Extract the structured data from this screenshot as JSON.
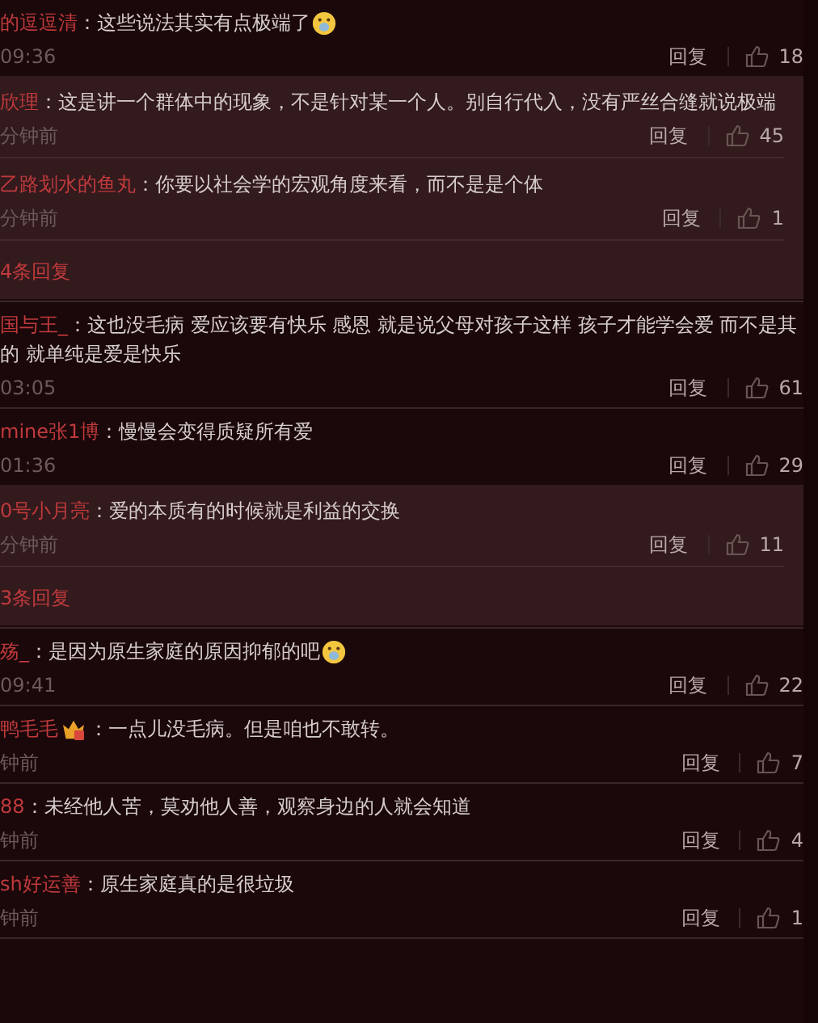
{
  "comments": [
    {
      "author": "的逗逗清",
      "text": "：这些说法其实有点极端了",
      "text_emoji": true,
      "author_badge": false,
      "time": "09:36",
      "reply": "回复",
      "likes": "18",
      "replies": [
        {
          "author": "欣理",
          "text": "：这是讲一个群体中的现象，不是针对某一个人。别自行代入，没有严丝合缝就说极端",
          "time": "分钟前",
          "reply": "回复",
          "likes": "45"
        },
        {
          "author": "乙路划水的鱼丸",
          "text": "：你要以社会学的宏观角度来看，而不是是个体",
          "time": "分钟前",
          "reply": "回复",
          "likes": "1"
        }
      ],
      "more": "4条回复"
    },
    {
      "author": "国与王_",
      "text": "：这也没毛病 爱应该要有快乐 感恩 就是说父母对孩子这样 孩子才能学会爱 而不是其的 就单纯是爱是快乐",
      "text_emoji": false,
      "author_badge": false,
      "time": "03:05",
      "reply": "回复",
      "likes": "61"
    },
    {
      "author": "mine张1博",
      "text": "：慢慢会变得质疑所有爱",
      "text_emoji": false,
      "author_badge": false,
      "time": "01:36",
      "reply": "回复",
      "likes": "29",
      "replies": [
        {
          "author": "0号小月亮",
          "text": "：爱的本质有的时候就是利益的交换",
          "time": "分钟前",
          "reply": "回复",
          "likes": "11"
        }
      ],
      "more": "3条回复"
    },
    {
      "author": "殇_",
      "text": "：是因为原生家庭的原因抑郁的吧",
      "text_emoji": true,
      "author_badge": false,
      "time": "09:41",
      "reply": "回复",
      "likes": "22"
    },
    {
      "author": "鸭毛毛",
      "text": "：一点儿没毛病。但是咱也不敢转。",
      "text_emoji": false,
      "author_badge": true,
      "time": "钟前",
      "reply": "回复",
      "likes": "7"
    },
    {
      "author": "88",
      "text": "：未经他人苦，莫劝他人善，观察身边的人就会知道",
      "text_emoji": false,
      "author_badge": false,
      "time": "钟前",
      "reply": "回复",
      "likes": "4"
    },
    {
      "author": "sh好运善",
      "text": "：原生家庭真的是很垃圾",
      "text_emoji": false,
      "author_badge": false,
      "time": "钟前",
      "reply": "回复",
      "likes": "1"
    }
  ]
}
